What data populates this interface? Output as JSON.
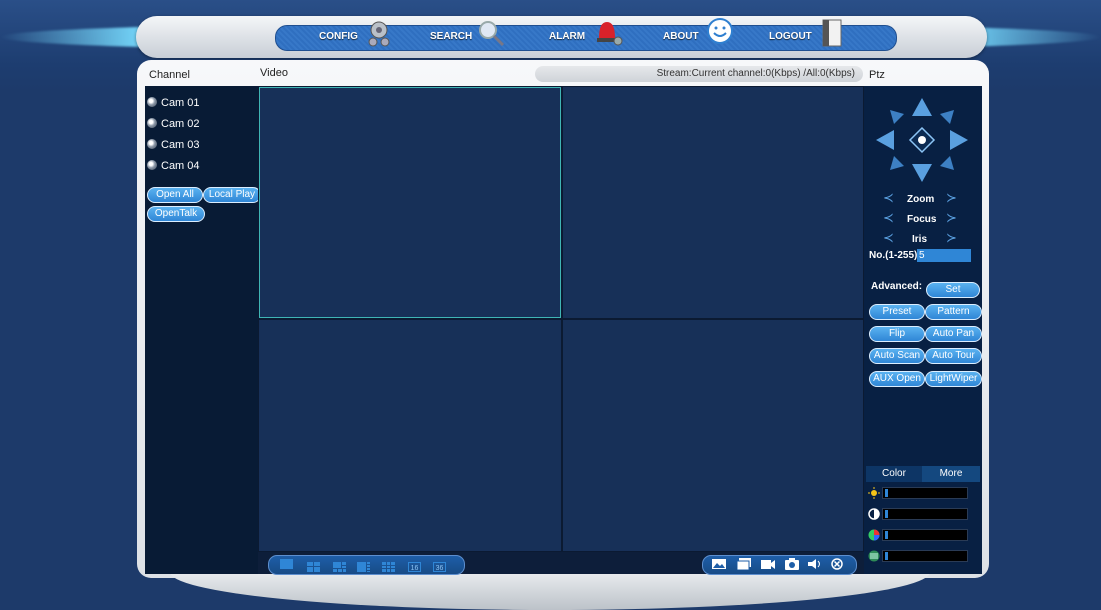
{
  "menu": {
    "config": "CONFIG",
    "search": "SEARCH",
    "alarm": "ALARM",
    "about": "ABOUT",
    "logout": "LOGOUT"
  },
  "headers": {
    "channel": "Channel",
    "video": "Video",
    "stream": "Stream:Current channel:0(Kbps) /All:0(Kbps)",
    "ptz": "Ptz"
  },
  "channels": [
    "Cam 01",
    "Cam 02",
    "Cam 03",
    "Cam 04"
  ],
  "channel_buttons": {
    "open_all": "Open All",
    "local_play": "Local Play",
    "open_talk": "OpenTalk"
  },
  "ptz": {
    "zoom": "Zoom",
    "focus": "Focus",
    "iris": "Iris",
    "number_label": "No.(1-255):",
    "number_value": "5",
    "advanced_label": "Advanced:",
    "set": "Set",
    "buttons": [
      "Preset",
      "Pattern",
      "Flip",
      "Auto Pan",
      "Auto Scan",
      "Auto Tour",
      "AUX Open",
      "LightWiper"
    ]
  },
  "color_tabs": {
    "color": "Color",
    "more": "More"
  },
  "colors": {
    "accent": "#2f86d6",
    "video_cell": "#173058",
    "selected_outline": "#3fb5b5"
  }
}
